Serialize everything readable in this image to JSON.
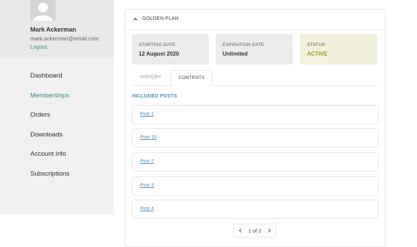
{
  "user": {
    "name": "Mark Ackerman",
    "email": "mark.ackerman@email.com",
    "logout_label": "Logout"
  },
  "nav": {
    "items": [
      {
        "label": "Dashboard"
      },
      {
        "label": "Memberships"
      },
      {
        "label": "Orders"
      },
      {
        "label": "Downloads"
      },
      {
        "label": "Account info"
      },
      {
        "label": "Subscriptions"
      }
    ],
    "active_index": 1
  },
  "plan": {
    "title": "GOLDEN PLAN",
    "starting_date_label": "STARTING DATE",
    "starting_date": "12 August 2020",
    "expiration_date_label": "EXPIRATION DATE",
    "expiration_date": "Unlimited",
    "status_label": "STATUS",
    "status": "ACTIVE"
  },
  "tabs": {
    "history": "HISTORY",
    "contents": "CONTENTS"
  },
  "included": {
    "heading": "INCLUDED POSTS",
    "posts": [
      "Post 1",
      "Post 10",
      "Post 2",
      "Post 3",
      "Post 4"
    ]
  },
  "pagination": {
    "label": "1 of 2"
  },
  "colors": {
    "accent_teal": "#3d8a82",
    "status_green": "#8ba51f",
    "link_blue": "#4a88b4"
  }
}
